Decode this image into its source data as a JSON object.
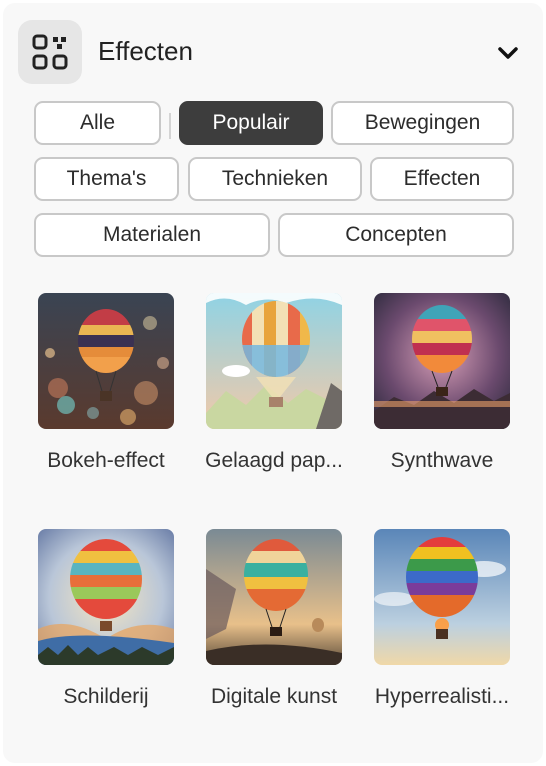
{
  "header": {
    "title": "Effecten",
    "icon": "effects-grid-icon",
    "collapse_icon": "chevron-down-icon"
  },
  "filters": [
    {
      "label": "Alle",
      "active": false
    },
    {
      "label": "Populair",
      "active": true
    },
    {
      "label": "Bewegingen",
      "active": false
    },
    {
      "label": "Thema's",
      "active": false
    },
    {
      "label": "Technieken",
      "active": false
    },
    {
      "label": "Effecten",
      "active": false
    },
    {
      "label": "Materialen",
      "active": false
    },
    {
      "label": "Concepten",
      "active": false
    }
  ],
  "effects": [
    {
      "label": "Bokeh-effect"
    },
    {
      "label": "Gelaagd pap..."
    },
    {
      "label": "Synthwave"
    },
    {
      "label": "Schilderij"
    },
    {
      "label": "Digitale kunst"
    },
    {
      "label": "Hyperrealisti..."
    }
  ],
  "colors": {
    "active_chip": "#3d3d3d",
    "chip_border": "#c8c8c8",
    "panel": "#f8f8f8"
  }
}
